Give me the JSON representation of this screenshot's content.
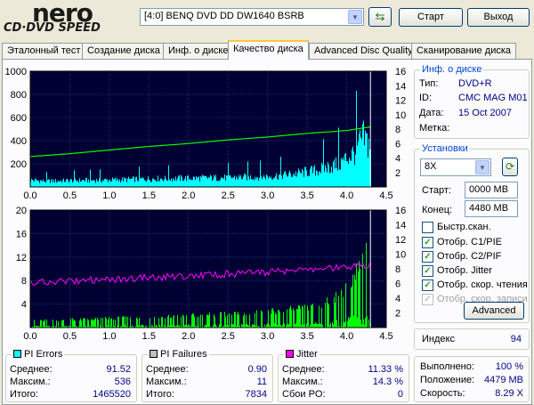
{
  "header": {
    "logo_top": "nero",
    "logo_bottom": "CD·DVD SPEED",
    "drive": "[4:0]  BENQ DVD DD DW1640 BSRB",
    "start_label": "Старт",
    "exit_label": "Выход",
    "drive_icon": "drive-swap-icon"
  },
  "tabs": [
    {
      "label": "Эталонный тест"
    },
    {
      "label": "Создание диска"
    },
    {
      "label": "Инф. о диске"
    },
    {
      "label": "Качество диска",
      "active": true
    },
    {
      "label": "Advanced Disc Quality"
    },
    {
      "label": "Сканирование диска"
    }
  ],
  "chart_data": [
    {
      "type": "area",
      "x_ticks": [
        "0.0",
        "0.5",
        "1.0",
        "1.5",
        "2.0",
        "2.5",
        "3.0",
        "3.5",
        "4.0",
        "4.5"
      ],
      "y_left_ticks": [
        "1000",
        "800",
        "600",
        "400",
        "200"
      ],
      "y_right_ticks": [
        "16",
        "14",
        "12",
        "10",
        "8",
        "6",
        "4",
        "2"
      ],
      "xlim": [
        0,
        4.5
      ],
      "ylim_left": [
        0,
        1000
      ],
      "ylim_right": [
        0,
        16
      ],
      "series": [
        {
          "color": "#00ffff",
          "x": [
            0,
            0.2,
            0.5,
            1.0,
            1.5,
            2.0,
            2.5,
            3.0,
            3.3,
            3.6,
            3.9,
            4.1,
            4.2,
            4.3
          ],
          "values": [
            60,
            50,
            55,
            60,
            70,
            75,
            80,
            90,
            110,
            140,
            200,
            300,
            420,
            360
          ]
        },
        {
          "color": "#00ff00",
          "x": [
            0,
            0.5,
            1.0,
            1.5,
            2.0,
            2.5,
            3.0,
            3.5,
            4.0,
            4.3
          ],
          "speed": [
            4.2,
            4.6,
            5.1,
            5.6,
            6.0,
            6.5,
            6.9,
            7.4,
            7.8,
            8.3
          ]
        }
      ]
    },
    {
      "type": "area",
      "x_ticks": [
        "0.0",
        "0.5",
        "1.0",
        "1.5",
        "2.0",
        "2.5",
        "3.0",
        "3.5",
        "4.0",
        "4.5"
      ],
      "y_left_ticks": [
        "20",
        "16",
        "12",
        "8",
        "4"
      ],
      "y_right_ticks": [
        "16",
        "14",
        "12",
        "10",
        "8",
        "6",
        "4",
        "2"
      ],
      "xlim": [
        0,
        4.5
      ],
      "ylim_left": [
        0,
        20
      ],
      "ylim_right": [
        0,
        16
      ],
      "series": [
        {
          "color": "#00ff00",
          "x": [
            0,
            0.5,
            1.0,
            1.5,
            2.0,
            2.5,
            3.0,
            3.5,
            3.8,
            4.0,
            4.2,
            4.3
          ],
          "values": [
            0.5,
            0.6,
            0.7,
            0.8,
            0.9,
            1.0,
            1.2,
            1.5,
            2.0,
            3.0,
            5.0,
            6.0
          ]
        },
        {
          "color": "#ff00ff",
          "x": [
            0,
            0.5,
            1.0,
            1.5,
            2.0,
            2.5,
            3.0,
            3.5,
            4.0,
            4.3
          ],
          "jitter": [
            7.6,
            7.9,
            8.2,
            8.5,
            8.8,
            9.1,
            9.4,
            9.8,
            10.2,
            10.5
          ]
        }
      ]
    }
  ],
  "disc_info": {
    "title": "Инф. о диске",
    "rows": [
      {
        "label": "Тип:",
        "value": "DVD+R"
      },
      {
        "label": "ID:",
        "value": "CMC MAG M01"
      },
      {
        "label": "Дата:",
        "value": "15 Oct 2007"
      },
      {
        "label": "Метка:",
        "value": ""
      }
    ]
  },
  "settings": {
    "title": "Установки",
    "speed": "8X",
    "refresh_icon": "refresh-icon",
    "start_label": "Старт:",
    "start_value": "0000 MB",
    "end_label": "Конец:",
    "end_value": "4480 MB",
    "checks": [
      {
        "label": "Быстр.скан.",
        "checked": false,
        "disabled": false
      },
      {
        "label": "Отобр. C1/PIE",
        "checked": true,
        "disabled": false
      },
      {
        "label": "Отобр. C2/PIF",
        "checked": true,
        "disabled": false
      },
      {
        "label": "Отобр. Jitter",
        "checked": true,
        "disabled": false
      },
      {
        "label": "Отобр. скор. чтения",
        "checked": true,
        "disabled": false
      },
      {
        "label": "Отобр. скор. записи",
        "checked": true,
        "disabled": true
      }
    ],
    "advanced_label": "Advanced"
  },
  "index": {
    "label": "Индекс",
    "value": "94"
  },
  "progress": {
    "rows": [
      {
        "label": "Выполнено:",
        "value": "100 %"
      },
      {
        "label": "Положение:",
        "value": "4479 MB"
      },
      {
        "label": "Скорость:",
        "value": "8.29 X"
      }
    ]
  },
  "pi_errors": {
    "title": "PI Errors",
    "color": "#00ffff",
    "rows": [
      {
        "label": "Среднее:",
        "value": "91.52"
      },
      {
        "label": "Максим.:",
        "value": "536"
      },
      {
        "label": "Итого:",
        "value": "1465520"
      }
    ]
  },
  "pi_failures": {
    "title": "PI Failures",
    "color": "#c0c0c0",
    "rows": [
      {
        "label": "Среднее:",
        "value": "0.90"
      },
      {
        "label": "Максим.:",
        "value": "11"
      },
      {
        "label": "Итого:",
        "value": "7834"
      }
    ]
  },
  "jitter": {
    "title": "Jitter",
    "color": "#ff00ff",
    "rows": [
      {
        "label": "Среднее:",
        "value": "11.33 %"
      },
      {
        "label": "Максим.:",
        "value": "14.3 %"
      },
      {
        "label": "Сбои PO:",
        "value": "0"
      }
    ]
  }
}
